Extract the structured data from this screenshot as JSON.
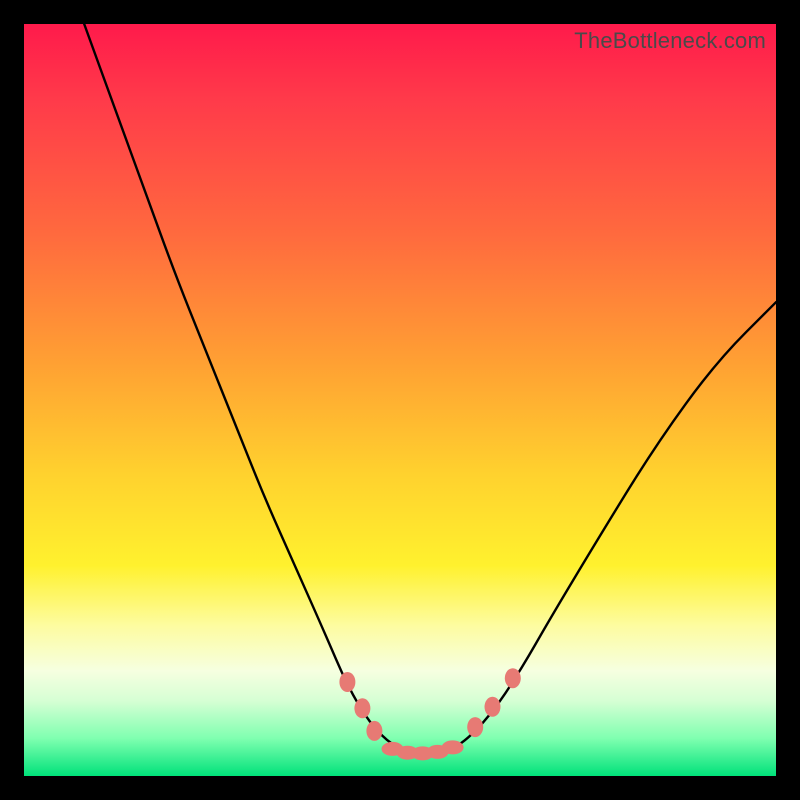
{
  "watermark": "TheBottleneck.com",
  "colors": {
    "frame": "#000000",
    "gradient_top": "#ff1a4b",
    "gradient_mid": "#ffd22e",
    "gradient_bottom": "#00e27a",
    "curve": "#000000",
    "beads": "#e77a74"
  },
  "chart_data": {
    "type": "line",
    "title": "",
    "xlabel": "",
    "ylabel": "",
    "xlim": [
      0,
      100
    ],
    "ylim": [
      0,
      100
    ],
    "note": "No axes, gridlines, or tick labels are shown; values are estimated from pixel positions where y=0 is the bottom green band and y=100 is the top pink edge.",
    "series": [
      {
        "name": "bottleneck-curve",
        "x": [
          8,
          12,
          16,
          20,
          24,
          28,
          32,
          36,
          40,
          43,
          46,
          49,
          52,
          55,
          58,
          62,
          66,
          70,
          76,
          84,
          92,
          100
        ],
        "y": [
          100,
          89,
          78,
          67,
          57,
          47,
          37,
          28,
          19,
          12,
          7,
          4,
          3,
          3,
          4,
          8,
          14,
          21,
          31,
          44,
          55,
          63
        ]
      }
    ],
    "markers": [
      {
        "name": "bead-left-upper",
        "x": 43.0,
        "y": 12.5
      },
      {
        "name": "bead-left-mid",
        "x": 45.0,
        "y": 9.0
      },
      {
        "name": "bead-left-lower",
        "x": 46.6,
        "y": 6.0
      },
      {
        "name": "bead-bottom-1",
        "x": 49.0,
        "y": 3.6
      },
      {
        "name": "bead-bottom-2",
        "x": 51.0,
        "y": 3.1
      },
      {
        "name": "bead-bottom-3",
        "x": 53.0,
        "y": 3.0
      },
      {
        "name": "bead-bottom-4",
        "x": 55.0,
        "y": 3.2
      },
      {
        "name": "bead-bottom-5",
        "x": 57.0,
        "y": 3.8
      },
      {
        "name": "bead-right-lower",
        "x": 60.0,
        "y": 6.5
      },
      {
        "name": "bead-right-mid",
        "x": 62.3,
        "y": 9.2
      },
      {
        "name": "bead-right-upper",
        "x": 65.0,
        "y": 13.0
      }
    ]
  }
}
